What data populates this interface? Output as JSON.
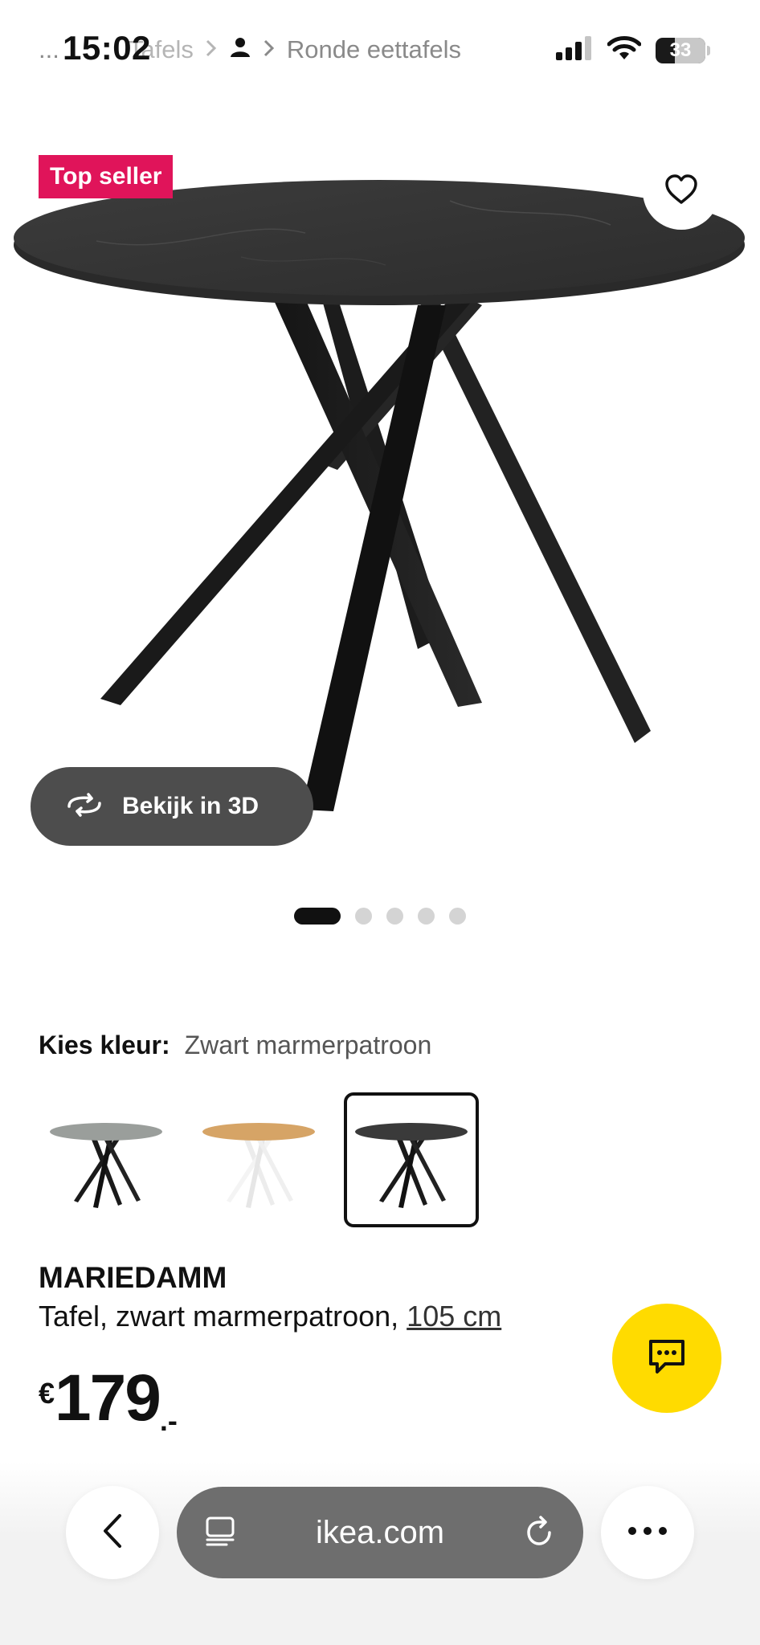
{
  "status_bar": {
    "time": "15:02",
    "battery": "33"
  },
  "breadcrumb": {
    "ellipsis": "...",
    "faded_item": "Tafels",
    "current": "Ronde eettafels"
  },
  "product_image": {
    "badge": "Top seller",
    "view_3d_label": "Bekijk in 3D",
    "slide_count": 5,
    "active_slide": 1
  },
  "color": {
    "label": "Kies kleur:",
    "selected": "Zwart marmerpatroon",
    "swatches": [
      {
        "name": "grijs-marmer",
        "top": "#9a9e9b",
        "legs": "#1a1a1a"
      },
      {
        "name": "eiken",
        "top": "#d6a466",
        "legs": "#f2f2f2"
      },
      {
        "name": "zwart-marmer",
        "top": "#3a3a3a",
        "legs": "#1a1a1a"
      }
    ]
  },
  "product": {
    "name": "MARIEDAMM",
    "description": "Tafel, zwart marmerpatroon,",
    "size": "105 cm",
    "price_currency": "€",
    "price_amount": "179",
    "price_suffix": ".-"
  },
  "browser": {
    "url": "ikea.com"
  },
  "colors": {
    "badge": "#e0145a",
    "chat": "#ffdb00",
    "view3d_bg": "#4d4d4d",
    "url_bar": "#6e6e6e"
  }
}
